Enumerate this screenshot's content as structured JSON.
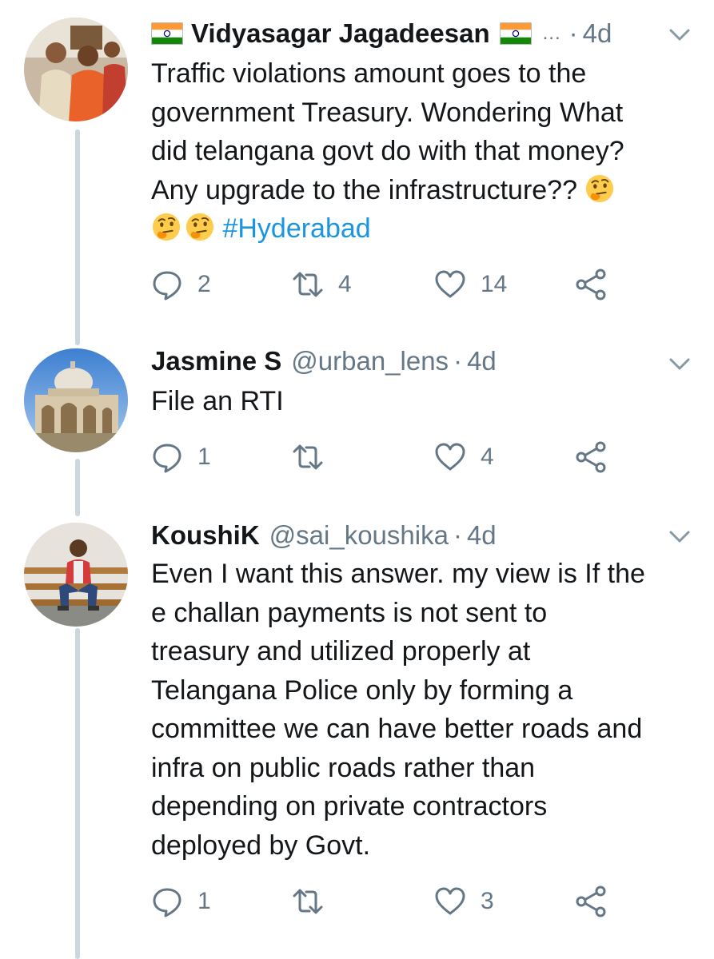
{
  "tweets": [
    {
      "name": "Vidyasagar Jagadeesan",
      "handle_truncated": "...",
      "time": "4d",
      "text_lines": [
        "Traffic violations amount goes to the",
        "government Treasury. Wondering What",
        "did telangana govt do with that money?",
        "Any upgrade to the infrastructure??"
      ],
      "hashtag": "#Hyderabad",
      "replies": "2",
      "retweets": "4",
      "likes": "14"
    },
    {
      "name": "Jasmine S",
      "handle": "@urban_lens",
      "time": "4d",
      "text_lines": [
        "File an RTI"
      ],
      "replies": "1",
      "retweets": "",
      "likes": "4"
    },
    {
      "name": "KoushiK",
      "handle": "@sai_koushika",
      "time": "4d",
      "text_lines": [
        "Even I want this answer. my view is If the",
        "e challan payments is not sent to",
        "treasury and utilized properly at",
        "Telangana Police only by forming a",
        "committee we can have better roads and",
        "infra on public roads rather than",
        "depending on private contractors",
        "deployed by Govt."
      ],
      "replies": "1",
      "retweets": "",
      "likes": "3"
    }
  ],
  "dot": "·",
  "colors": {
    "hashtag": "#1b95e0",
    "meta": "#657786",
    "thread_line": "#ccd6dd"
  },
  "icons": [
    "reply-icon",
    "retweet-icon",
    "like-icon",
    "share-icon",
    "caret-down-icon",
    "india-flag-icon",
    "thinking-face-emoji"
  ]
}
